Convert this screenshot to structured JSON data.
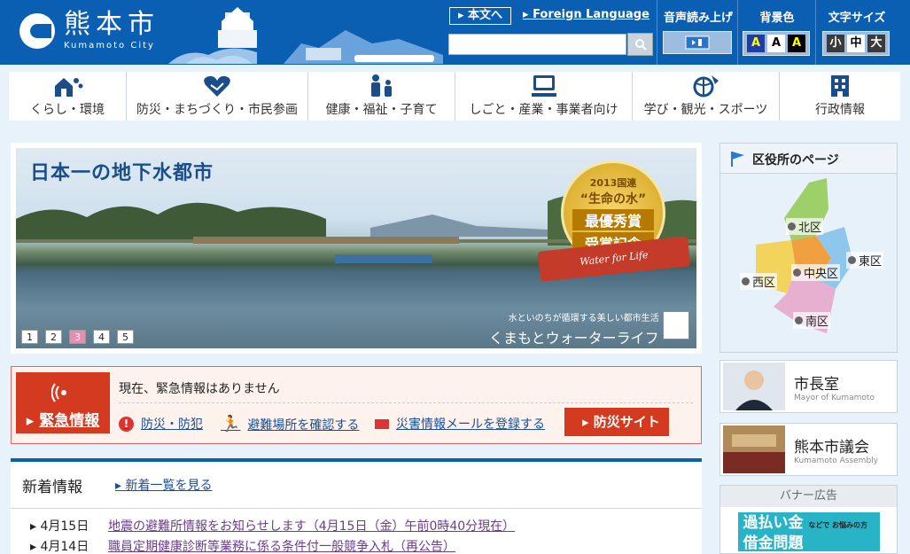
{
  "header": {
    "logo_jp": "熊本市",
    "logo_en": "Kumamoto City",
    "skip_label": "本文へ",
    "foreign_language": "Foreign Language",
    "search": {
      "placeholder": "",
      "value": ""
    },
    "voice_label": "音声読み上げ",
    "bg_color_label": "背景色",
    "text_size_label": "文字サイズ",
    "bg_buttons": [
      "A",
      "A",
      "A"
    ],
    "size_buttons": [
      "小",
      "中",
      "大"
    ]
  },
  "global_nav": [
    {
      "label": "くらし・環境",
      "icon": "house-rain-icon"
    },
    {
      "label": "防災・まちづくり・市民参画",
      "icon": "handshake-heart-icon"
    },
    {
      "label": "健康・福祉・子育て",
      "icon": "family-icon"
    },
    {
      "label": "しごと・産業・事業者向け",
      "icon": "computer-icon"
    },
    {
      "label": "学び・観光・スポーツ",
      "icon": "ball-icon"
    },
    {
      "label": "行政情報",
      "icon": "building-icon"
    }
  ],
  "hero": {
    "title": "日本一の地下水都市",
    "medal_line1": "2013国連",
    "medal_line2": "“生命の水”",
    "medal_line3": "最優秀賞",
    "medal_line4": "受賞記念",
    "ribbon": "Water for Life",
    "caption_small": "水といのちが循環する美しい都市生活",
    "caption_big": "くまもとウォーターライフ",
    "slides": [
      "1",
      "2",
      "3",
      "4",
      "5"
    ],
    "active_slide": "3"
  },
  "emergency": {
    "badge": "緊急情報",
    "notice": "現在、緊急情報はありません",
    "links": [
      "防災・防犯",
      "避難場所を確認する",
      "災害情報メールを登録する"
    ],
    "button": "防災サイト"
  },
  "news": {
    "title": "新着情報",
    "all_link": "新着一覧を見る",
    "items": [
      {
        "date": "4月15日",
        "title": "地震の避難所情報をお知らせします（4月15日（金）午前0時40分現在）"
      },
      {
        "date": "4月14日",
        "title": "職員定期健康診断等業務に係る条件付一般競争入札（再公告）"
      }
    ]
  },
  "sidebar": {
    "ward_title": "区役所のページ",
    "wards": [
      "北区",
      "東区",
      "中央区",
      "西区",
      "南区"
    ],
    "mayor_title": "市長室",
    "mayor_sub": "Mayor of Kumamoto",
    "assembly_title": "熊本市議会",
    "assembly_sub": "Kumamoto Assembly",
    "banner_head": "バナー広告",
    "banner_text1": "過払い金",
    "banner_text2": "借金問題",
    "banner_small": "などで お悩みの方"
  },
  "colors": {
    "brand": "#0b5fb3",
    "emergency": "#d33a20",
    "medal": "#e0b030",
    "active_slide": "#e88cb0"
  }
}
